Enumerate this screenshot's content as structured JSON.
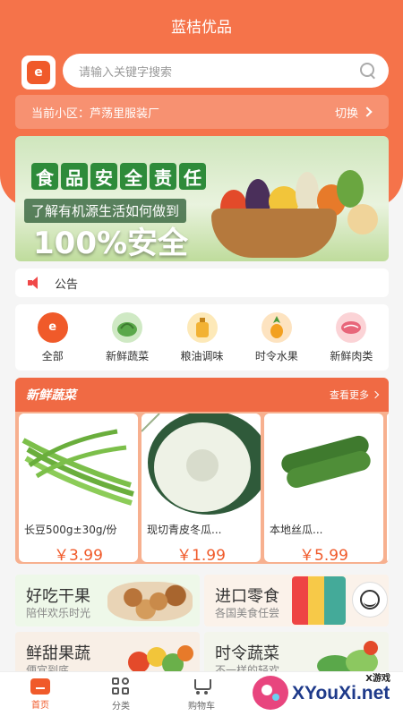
{
  "app": {
    "title": "蓝桔优品"
  },
  "search": {
    "placeholder": "请输入关键字搜索"
  },
  "community": {
    "label": "当前小区：芦荡里服装厂",
    "switch_label": "切换"
  },
  "banner": {
    "headline_chars": [
      "食",
      "品",
      "安",
      "全",
      "责",
      "任"
    ],
    "subtitle": "了解有机源生活如何做到",
    "big_text": "100%安全"
  },
  "notice": {
    "label": "公告"
  },
  "categories": [
    {
      "label": "全部",
      "icon": "store-bag-icon",
      "color": "#f05a2a"
    },
    {
      "label": "新鲜蔬菜",
      "icon": "vegetable-icon",
      "color": "#5aa84a"
    },
    {
      "label": "粮油调味",
      "icon": "oil-bottle-icon",
      "color": "#f2b234"
    },
    {
      "label": "时令水果",
      "icon": "pineapple-icon",
      "color": "#f2a020"
    },
    {
      "label": "新鲜肉类",
      "icon": "meat-icon",
      "color": "#e8667a"
    }
  ],
  "fresh_section": {
    "title": "新鲜蔬菜",
    "more_label": "查看更多",
    "products": [
      {
        "name": "长豆500g±30g/份",
        "price": "￥3.99",
        "icon": "long-bean-icon"
      },
      {
        "name": "现切青皮冬瓜...",
        "price": "￥1.99",
        "icon": "winter-melon-icon"
      },
      {
        "name": "本地丝瓜...",
        "price": "￥5.99",
        "icon": "loofah-icon"
      }
    ]
  },
  "promos": [
    {
      "title": "好吃干果",
      "subtitle": "陪伴欢乐时光"
    },
    {
      "title": "进口零食",
      "subtitle": "各国美食任尝"
    },
    {
      "title": "鲜甜果蔬",
      "subtitle": "便宜到底"
    },
    {
      "title": "时令蔬菜",
      "subtitle": "不一样的轻欢"
    }
  ],
  "tabs": [
    {
      "label": "首页",
      "icon": "home-icon",
      "active": true
    },
    {
      "label": "分类",
      "icon": "category-grid-icon",
      "active": false
    },
    {
      "label": "购物车",
      "icon": "cart-icon",
      "active": false
    }
  ],
  "watermark": {
    "small": "X游戏",
    "big": "XYouXi.net"
  },
  "colors": {
    "accent": "#f5734a",
    "price": "#f05a2a",
    "section_header": "#f06a44"
  }
}
